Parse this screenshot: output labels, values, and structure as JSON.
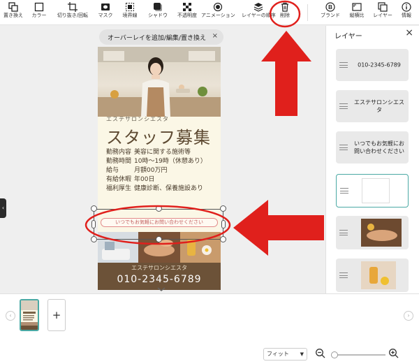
{
  "toolbar": {
    "tools": [
      {
        "id": "replace",
        "label": "置き換え",
        "icon": "replace-image-icon"
      },
      {
        "id": "color",
        "label": "カラー",
        "icon": "color-square-icon"
      },
      {
        "id": "crop",
        "label": "切り抜き/回転",
        "icon": "crop-icon"
      },
      {
        "id": "mask",
        "label": "マスク",
        "icon": "mask-icon"
      },
      {
        "id": "border",
        "label": "境界線",
        "icon": "border-icon"
      },
      {
        "id": "shadow",
        "label": "シャドウ",
        "icon": "shadow-icon"
      },
      {
        "id": "opacity",
        "label": "不透明度",
        "icon": "opacity-checker-icon"
      },
      {
        "id": "animation",
        "label": "アニメーション",
        "icon": "animation-icon"
      },
      {
        "id": "layer-order",
        "label": "レイヤーの順序",
        "icon": "layer-stack-icon"
      },
      {
        "id": "delete",
        "label": "削除",
        "icon": "trash-icon"
      },
      {
        "id": "brand",
        "label": "ブランド",
        "icon": "brand-b-icon"
      },
      {
        "id": "aspect",
        "label": "縦横比",
        "icon": "aspect-ratio-icon"
      },
      {
        "id": "layers",
        "label": "レイヤー",
        "icon": "layers-icon"
      },
      {
        "id": "info",
        "label": "情報",
        "icon": "info-icon"
      }
    ]
  },
  "overlay_bar": {
    "text": "オーバーレイを追加/編集/置き換え",
    "close": "×"
  },
  "design": {
    "subtitle": "エステサロンシエスタ",
    "title": "スタッフ募集",
    "details": [
      {
        "key": "勤務内容",
        "value": "美容に関する施術等"
      },
      {
        "key": "勤務時間",
        "value": "10時～19時（休憩あり）"
      },
      {
        "key": "給与",
        "value": "月額00万円"
      },
      {
        "key": "有給休暇",
        "value": "年00日"
      },
      {
        "key": "福利厚生",
        "value": "健康診断、保養施設あり"
      }
    ],
    "cta": "いつでもお気軽にお問い合わせください",
    "footer_name": "エステサロンシエスタ",
    "phone": "010-2345-6789"
  },
  "layers_panel": {
    "title": "レイヤー",
    "close": "×",
    "items": [
      {
        "type": "text",
        "text": "010-2345-6789"
      },
      {
        "type": "text",
        "text": "エステサロンシエスタ"
      },
      {
        "type": "text",
        "text": "いつでもお気軽にお問い合わせください"
      },
      {
        "type": "image",
        "selected": true
      },
      {
        "type": "image"
      },
      {
        "type": "image"
      }
    ]
  },
  "pages": {
    "add": "+",
    "prev": "‹",
    "next": "›"
  },
  "zoom": {
    "fit_label": "フィット"
  },
  "colors": {
    "accent": "#4aa9a4",
    "annotation": "#e0201c",
    "brown": "#6c5238"
  }
}
